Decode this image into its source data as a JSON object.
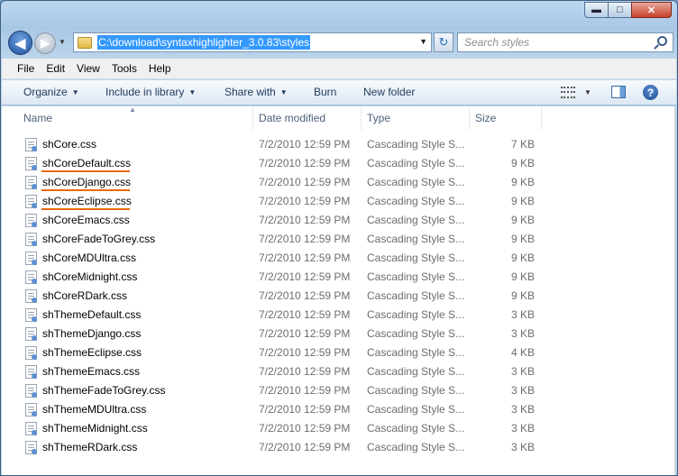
{
  "window": {
    "title_ghost": "",
    "controls": {
      "minimize": "▬",
      "maximize": "□",
      "close": "✕"
    }
  },
  "navigation": {
    "back": "◀",
    "forward": "▶",
    "address": "C:\\download\\syntaxhighlighter_3.0.83\\styles",
    "search_placeholder": "Search styles",
    "refresh": "↻"
  },
  "menu": [
    "File",
    "Edit",
    "View",
    "Tools",
    "Help"
  ],
  "toolbar": {
    "organize": "Organize",
    "include_in_library": "Include in library",
    "share_with": "Share with",
    "burn": "Burn",
    "new_folder": "New folder"
  },
  "columns": {
    "name": "Name",
    "date": "Date modified",
    "type": "Type",
    "size": "Size"
  },
  "files": [
    {
      "name": "shCore.css",
      "date": "7/2/2010 12:59 PM",
      "type": "Cascading Style S...",
      "size": "7 KB",
      "highlighted": false
    },
    {
      "name": "shCoreDefault.css",
      "date": "7/2/2010 12:59 PM",
      "type": "Cascading Style S...",
      "size": "9 KB",
      "highlighted": true
    },
    {
      "name": "shCoreDjango.css",
      "date": "7/2/2010 12:59 PM",
      "type": "Cascading Style S...",
      "size": "9 KB",
      "highlighted": true
    },
    {
      "name": "shCoreEclipse.css",
      "date": "7/2/2010 12:59 PM",
      "type": "Cascading Style S...",
      "size": "9 KB",
      "highlighted": true
    },
    {
      "name": "shCoreEmacs.css",
      "date": "7/2/2010 12:59 PM",
      "type": "Cascading Style S...",
      "size": "9 KB",
      "highlighted": false
    },
    {
      "name": "shCoreFadeToGrey.css",
      "date": "7/2/2010 12:59 PM",
      "type": "Cascading Style S...",
      "size": "9 KB",
      "highlighted": false
    },
    {
      "name": "shCoreMDUltra.css",
      "date": "7/2/2010 12:59 PM",
      "type": "Cascading Style S...",
      "size": "9 KB",
      "highlighted": false
    },
    {
      "name": "shCoreMidnight.css",
      "date": "7/2/2010 12:59 PM",
      "type": "Cascading Style S...",
      "size": "9 KB",
      "highlighted": false
    },
    {
      "name": "shCoreRDark.css",
      "date": "7/2/2010 12:59 PM",
      "type": "Cascading Style S...",
      "size": "9 KB",
      "highlighted": false
    },
    {
      "name": "shThemeDefault.css",
      "date": "7/2/2010 12:59 PM",
      "type": "Cascading Style S...",
      "size": "3 KB",
      "highlighted": false
    },
    {
      "name": "shThemeDjango.css",
      "date": "7/2/2010 12:59 PM",
      "type": "Cascading Style S...",
      "size": "3 KB",
      "highlighted": false
    },
    {
      "name": "shThemeEclipse.css",
      "date": "7/2/2010 12:59 PM",
      "type": "Cascading Style S...",
      "size": "4 KB",
      "highlighted": false
    },
    {
      "name": "shThemeEmacs.css",
      "date": "7/2/2010 12:59 PM",
      "type": "Cascading Style S...",
      "size": "3 KB",
      "highlighted": false
    },
    {
      "name": "shThemeFadeToGrey.css",
      "date": "7/2/2010 12:59 PM",
      "type": "Cascading Style S...",
      "size": "3 KB",
      "highlighted": false
    },
    {
      "name": "shThemeMDUltra.css",
      "date": "7/2/2010 12:59 PM",
      "type": "Cascading Style S...",
      "size": "3 KB",
      "highlighted": false
    },
    {
      "name": "shThemeMidnight.css",
      "date": "7/2/2010 12:59 PM",
      "type": "Cascading Style S...",
      "size": "3 KB",
      "highlighted": false
    },
    {
      "name": "shThemeRDark.css",
      "date": "7/2/2010 12:59 PM",
      "type": "Cascading Style S...",
      "size": "3 KB",
      "highlighted": false
    }
  ],
  "colors": {
    "highlight_underline": "#e86a10",
    "address_selection": "#3399ff"
  }
}
